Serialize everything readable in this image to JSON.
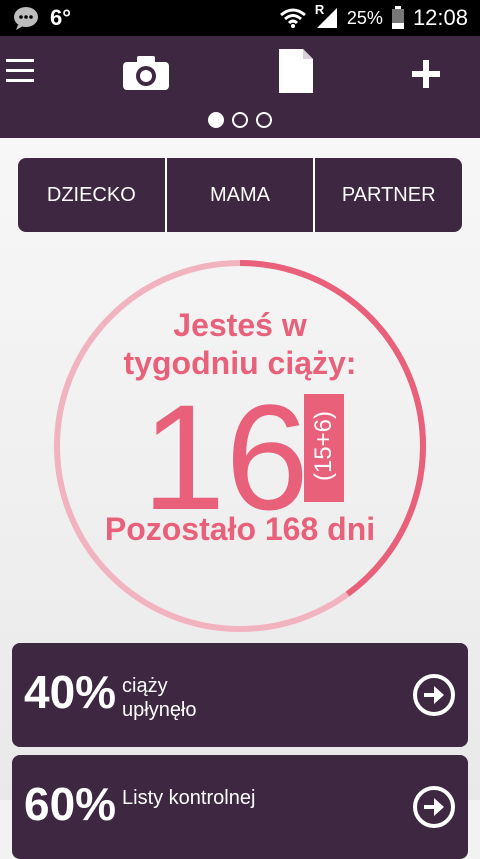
{
  "status_bar": {
    "temperature": "6°",
    "battery": "25%",
    "time": "12:08",
    "signal_letter": "R"
  },
  "toolbar": {
    "menu_icon": "hamburger-icon",
    "camera_icon": "camera-icon",
    "document_icon": "document-icon",
    "add_icon": "plus-icon",
    "pager_active_index": 0,
    "pager_count": 3
  },
  "tabs": [
    {
      "label": "DZIECKO"
    },
    {
      "label": "MAMA"
    },
    {
      "label": "PARTNER"
    }
  ],
  "pregnancy": {
    "heading_line1": "Jesteś w",
    "heading_line2": "tygodniu ciąży:",
    "week": "16",
    "week_detail": "(15+6)",
    "remaining": "Pozostało 168 dni",
    "progress_fraction": 0.4
  },
  "cards": [
    {
      "percent": "40%",
      "line1": "ciąży",
      "line2": "upłynęło"
    },
    {
      "percent": "60%",
      "line1": "Listy kontrolnej",
      "line2": ""
    }
  ],
  "colors": {
    "primary": "#3e2740",
    "accent": "#e8607a",
    "ring_track": "#f1b3bf",
    "background": "#f2f2f2"
  }
}
